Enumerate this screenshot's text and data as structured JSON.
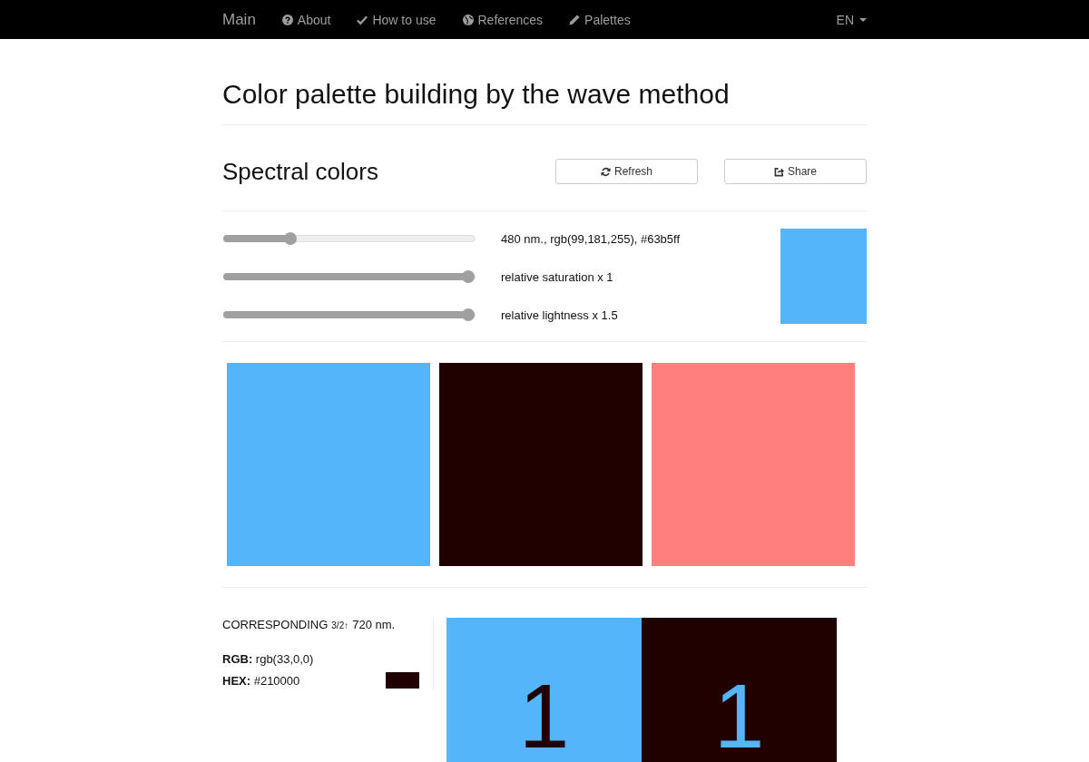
{
  "navbar": {
    "brand": "Main",
    "items": [
      {
        "label": "About"
      },
      {
        "label": "How to use"
      },
      {
        "label": "References"
      },
      {
        "label": "Palettes"
      }
    ],
    "language": "EN"
  },
  "page_title": "Color palette building by the wave method",
  "section": {
    "title": "Spectral colors",
    "buttons": [
      {
        "label": "Refresh"
      },
      {
        "label": "Share"
      }
    ]
  },
  "sliders": [
    {
      "level": 0.25,
      "reading": "480 nm., rgb(99,181,255), #63b5ff"
    },
    {
      "level": 1,
      "reading": "relative saturation x 1"
    },
    {
      "level": 1,
      "reading": "relative lightness x 1.5"
    }
  ],
  "preview": {
    "color": "#55b5fa"
  },
  "swatches": [
    {
      "color": "#55b5fa"
    },
    {
      "color": "#210000"
    },
    {
      "color": "#ff7f7f"
    }
  ],
  "corresponding": {
    "label": "CORRESPONDING",
    "ratio": "3/2↑",
    "wavelength": "720 nm.",
    "rgb": "**RGB:** rgb(33,0,0)",
    "hex": "**HEX:** #210000",
    "color": "#210000"
  },
  "contrast_tiles": [
    {
      "color": "#55b5fa",
      "number": {
        "label": "1",
        "color": "#210000"
      }
    },
    {
      "color": "#210000",
      "number": {
        "label": "1",
        "color": "#55b5fa"
      }
    }
  ]
}
